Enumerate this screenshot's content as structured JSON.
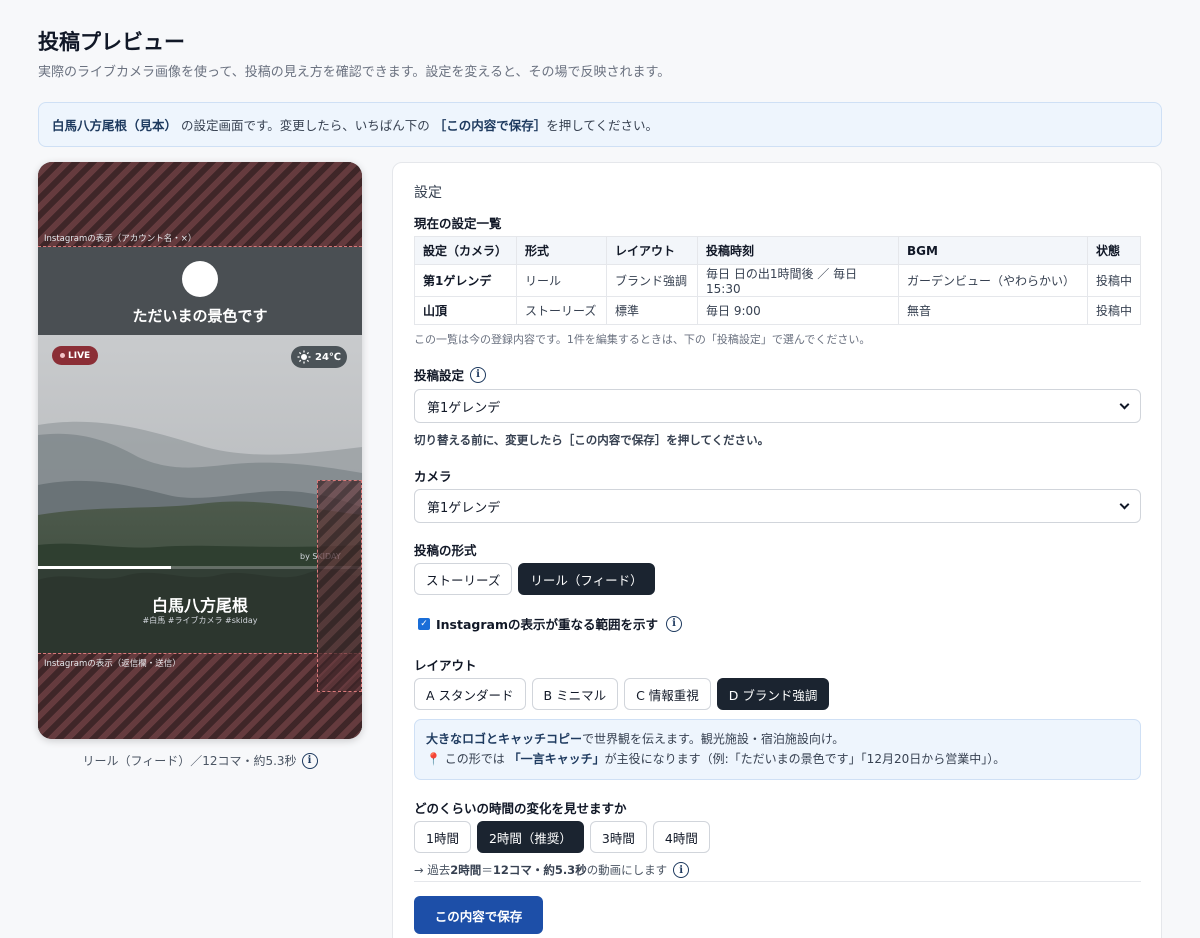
{
  "page": {
    "title": "投稿プレビュー",
    "subtitle": "実際のライブカメラ画像を使って、投稿の見え方を確認できます。設定を変えると、その場で反映されます。"
  },
  "notice": {
    "place": "白馬八方尾根（見本）",
    "text1": "の設定画面です。変更したら、いちばん下の",
    "button_ref": "［この内容で保存］",
    "text2": "を押してください。"
  },
  "preview": {
    "top_zone_label": "Instagramの表示（アカウント名・×）",
    "catch_copy": "ただいまの景色です",
    "live_badge": "LIVE",
    "temperature": "24℃",
    "watermark": "by SKIDAY",
    "location_title": "白馬八方尾根",
    "hashtags": "#白馬 #ライブカメラ #skiday",
    "bottom_zone_label": "Instagramの表示（返信欄・送信）",
    "caption": "リール（フィード）／12コマ・約5.3秒",
    "progress_fraction": 0.41,
    "colors": {
      "overlay": "#5b3b3e",
      "live": "#8b2e36",
      "band": "#4a4f53"
    }
  },
  "settings": {
    "heading": "設定",
    "summary_title": "現在の設定一覧",
    "table": {
      "headers": [
        "設定（カメラ）",
        "形式",
        "レイアウト",
        "投稿時刻",
        "BGM",
        "状態"
      ],
      "rows": [
        [
          "第1ゲレンデ",
          "リール",
          "ブランド強調",
          "毎日 日の出1時間後 ／ 毎日 15:30",
          "ガーデンビュー（やわらかい）",
          "投稿中"
        ],
        [
          "山頂",
          "ストーリーズ",
          "標準",
          "毎日 9:00",
          "無音",
          "投稿中"
        ]
      ]
    },
    "table_note": "この一覧は今の登録内容です。1件を編集するときは、下の「投稿設定」で選んでください。",
    "post_setting": {
      "label": "投稿設定",
      "value": "第1ゲレンデ",
      "hint": "切り替える前に、変更したら［この内容で保存］を押してください。"
    },
    "camera": {
      "label": "カメラ",
      "value": "第1ゲレンデ"
    },
    "format": {
      "label": "投稿の形式",
      "options": [
        "ストーリーズ",
        "リール（フィード）"
      ],
      "selected": "リール（フィード）"
    },
    "overlay_toggle": {
      "label": "Instagramの表示が重なる範囲を示す",
      "checked": true
    },
    "layout": {
      "label": "レイアウト",
      "options": [
        "A スタンダード",
        "B ミニマル",
        "C 情報重視",
        "D ブランド強調"
      ],
      "selected": "D ブランド強調",
      "info_strong": "大きなロゴとキャッチコピー",
      "info_rest": "で世界観を伝えます。観光施設・宿泊施設向け。",
      "info2_prefix": "この形では",
      "info2_strong": "「一言キャッチ」",
      "info2_rest": "が主役になります（例:「ただいまの景色です」「12月20日から営業中」）。"
    },
    "duration": {
      "label": "どのくらいの時間の変化を見せますか",
      "options": [
        "1時間",
        "2時間（推奨）",
        "3時間",
        "4時間"
      ],
      "selected": "2時間（推奨）",
      "summary_prefix": "→ 過去",
      "summary_hours": "2時間",
      "summary_eq": "＝",
      "summary_frames": "12コマ・約5.3秒",
      "summary_suffix": "の動画にします"
    },
    "save_label": "この内容で保存"
  }
}
